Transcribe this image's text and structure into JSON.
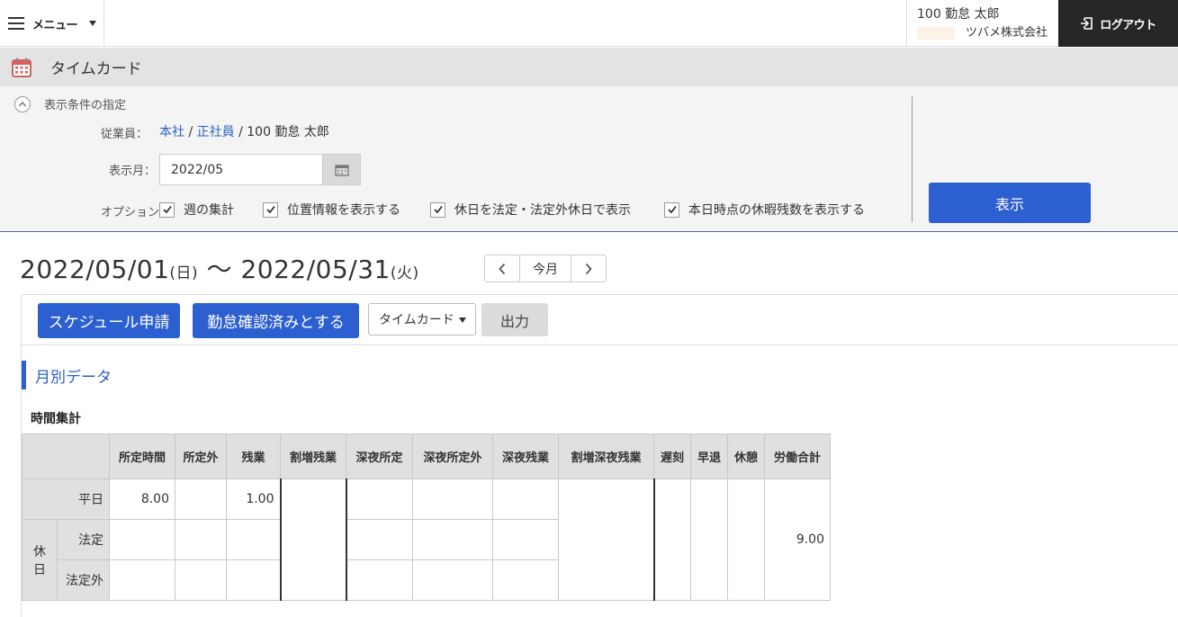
{
  "header": {
    "menu_label": "メニュー",
    "user_name": "100 勤怠 太郎",
    "company": "ツバメ株式会社",
    "logout_label": "ログアウト"
  },
  "page": {
    "title": "タイムカード"
  },
  "filter": {
    "title": "表示条件の指定",
    "employee_label": "従業員：",
    "employee_office": "本社",
    "employee_type": "正社員",
    "employee_sep": "/",
    "employee_name": "100 勤怠 太郎",
    "month_label": "表示月：",
    "month_value": "2022/05",
    "options_label": "オプション：",
    "options": [
      {
        "label": "週の集計",
        "checked": true
      },
      {
        "label": "位置情報を表示する",
        "checked": true
      },
      {
        "label": "休日を法定・法定外休日で表示",
        "checked": true
      },
      {
        "label": "本日時点の休暇残数を表示する",
        "checked": true
      }
    ],
    "show_button": "表示"
  },
  "range": {
    "start": "2022/05/01",
    "start_dow": "(日)",
    "tilde": "〜",
    "end": "2022/05/31",
    "end_dow": "(火)"
  },
  "pager": {
    "today_label": "今月"
  },
  "toolbar": {
    "schedule_button": "スケジュール申請",
    "confirm_button": "勤怠確認済みとする",
    "select_value": "タイムカード",
    "output_button": "出力"
  },
  "monthly": {
    "section_title": "月別データ",
    "sub_title": "時間集計",
    "columns": [
      "所定時間",
      "所定外",
      "残業",
      "割増残業",
      "深夜所定",
      "深夜所定外",
      "深夜残業",
      "割増深夜残業",
      "遅刻",
      "早退",
      "休憩",
      "労働合計"
    ],
    "row_weekday": "平日",
    "row_holiday": "休日",
    "row_legal": "法定",
    "row_nonlegal": "法定外",
    "weekday_scheduled": "8.00",
    "weekday_overtime": "1.00",
    "total": "9.00"
  },
  "colors": {
    "accent": "#2c5fcf",
    "link": "#2a62c4",
    "header_dark": "#262626",
    "title_bar": "#e3e3e3"
  },
  "icons": {
    "menu": "hamburger-icon",
    "logout": "logout-icon",
    "page": "calendar-icon",
    "toggle": "chevron-up-icon",
    "date_picker": "calendar-icon"
  }
}
